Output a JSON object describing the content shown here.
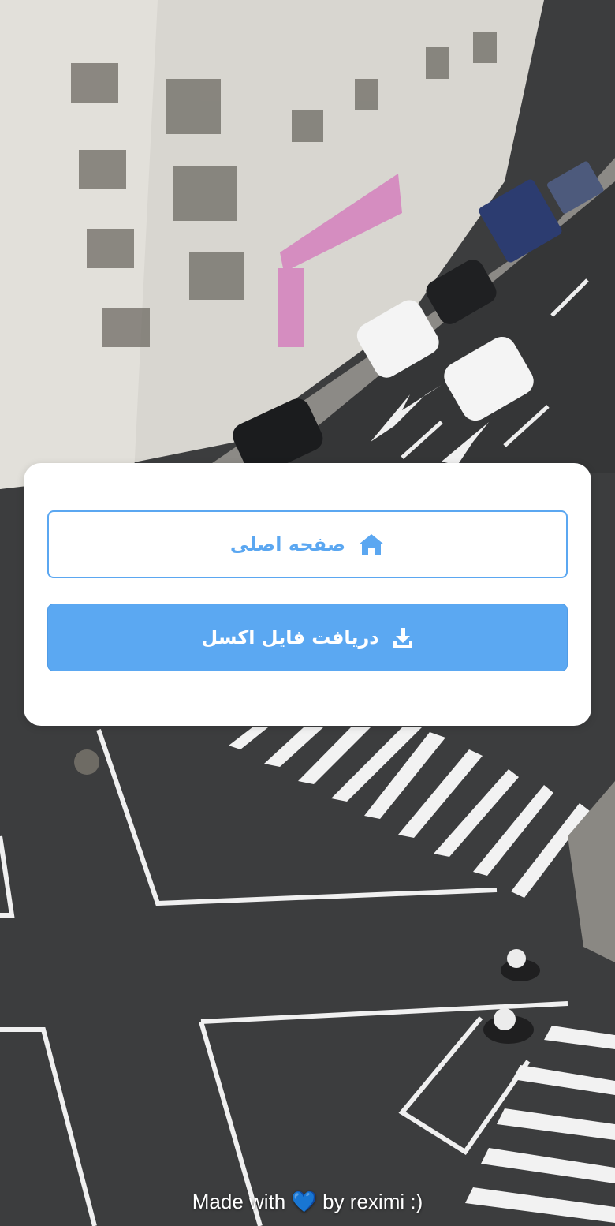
{
  "buttons": {
    "home_label": "صفحه اصلی",
    "download_label": "دریافت فایل اکسل"
  },
  "icons": {
    "home": "home-icon",
    "download": "download-icon"
  },
  "footer": {
    "prefix": "Made with",
    "heart": "💙",
    "suffix": "by reximi :)"
  },
  "colors": {
    "accent": "#5ba8f2",
    "card": "#ffffff"
  }
}
